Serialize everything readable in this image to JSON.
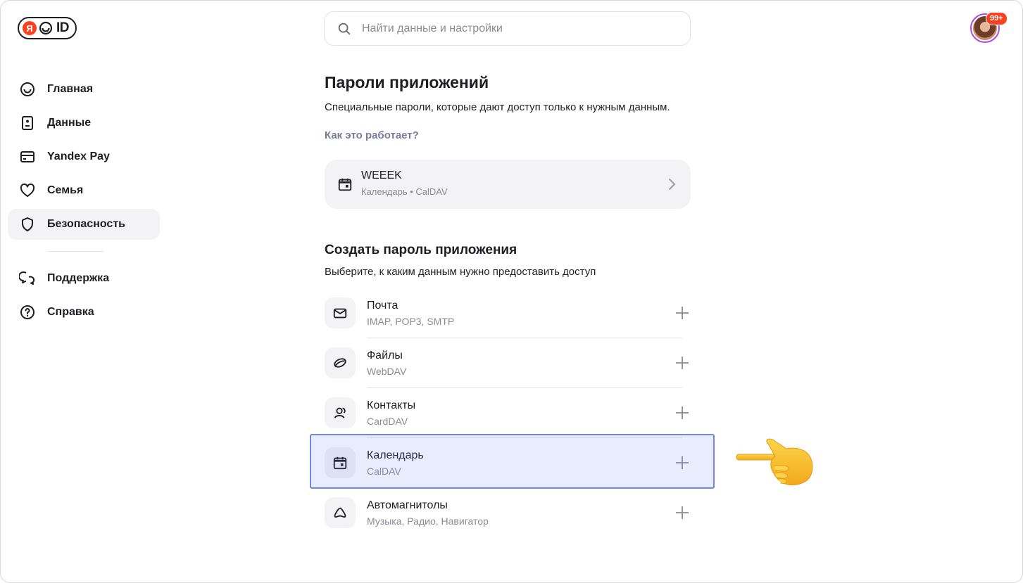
{
  "brand": {
    "ya": "Я",
    "id": "ID"
  },
  "search": {
    "placeholder": "Найти данные и настройки"
  },
  "avatar": {
    "badge": "99+"
  },
  "sidebar": {
    "items": [
      {
        "label": "Главная",
        "icon": "home-icon"
      },
      {
        "label": "Данные",
        "icon": "id-card-icon"
      },
      {
        "label": "Yandex Pay",
        "icon": "credit-card-icon"
      },
      {
        "label": "Семья",
        "icon": "heart-icon"
      },
      {
        "label": "Безопасность",
        "icon": "shield-icon",
        "active": true
      },
      {
        "label": "Поддержка",
        "icon": "chat-icon"
      },
      {
        "label": "Справка",
        "icon": "help-icon"
      }
    ]
  },
  "main": {
    "title": "Пароли приложений",
    "description": "Специальные пароли, которые дают доступ только к нужным данным.",
    "how_link": "Как это работает?",
    "existing": {
      "name": "WEEEK",
      "meta": "Календарь • CalDAV"
    },
    "create_title": "Создать пароль приложения",
    "create_subtitle": "Выберите, к каким данным нужно предоставить доступ",
    "options": [
      {
        "title": "Почта",
        "subtitle": "IMAP, POP3, SMTP",
        "icon": "mail-icon"
      },
      {
        "title": "Файлы",
        "subtitle": "WebDAV",
        "icon": "disk-icon"
      },
      {
        "title": "Контакты",
        "subtitle": "CardDAV",
        "icon": "contacts-icon"
      },
      {
        "title": "Календарь",
        "subtitle": "CalDAV",
        "icon": "calendar-icon",
        "highlighted": true
      },
      {
        "title": "Автомагнитолы",
        "subtitle": "Музыка, Радио, Навигатор",
        "icon": "car-icon"
      }
    ]
  },
  "colors": {
    "accent": "#fc3f1d",
    "highlight": "#7386e6",
    "muted": "#8b8b93",
    "link": "#7a7a9d"
  }
}
